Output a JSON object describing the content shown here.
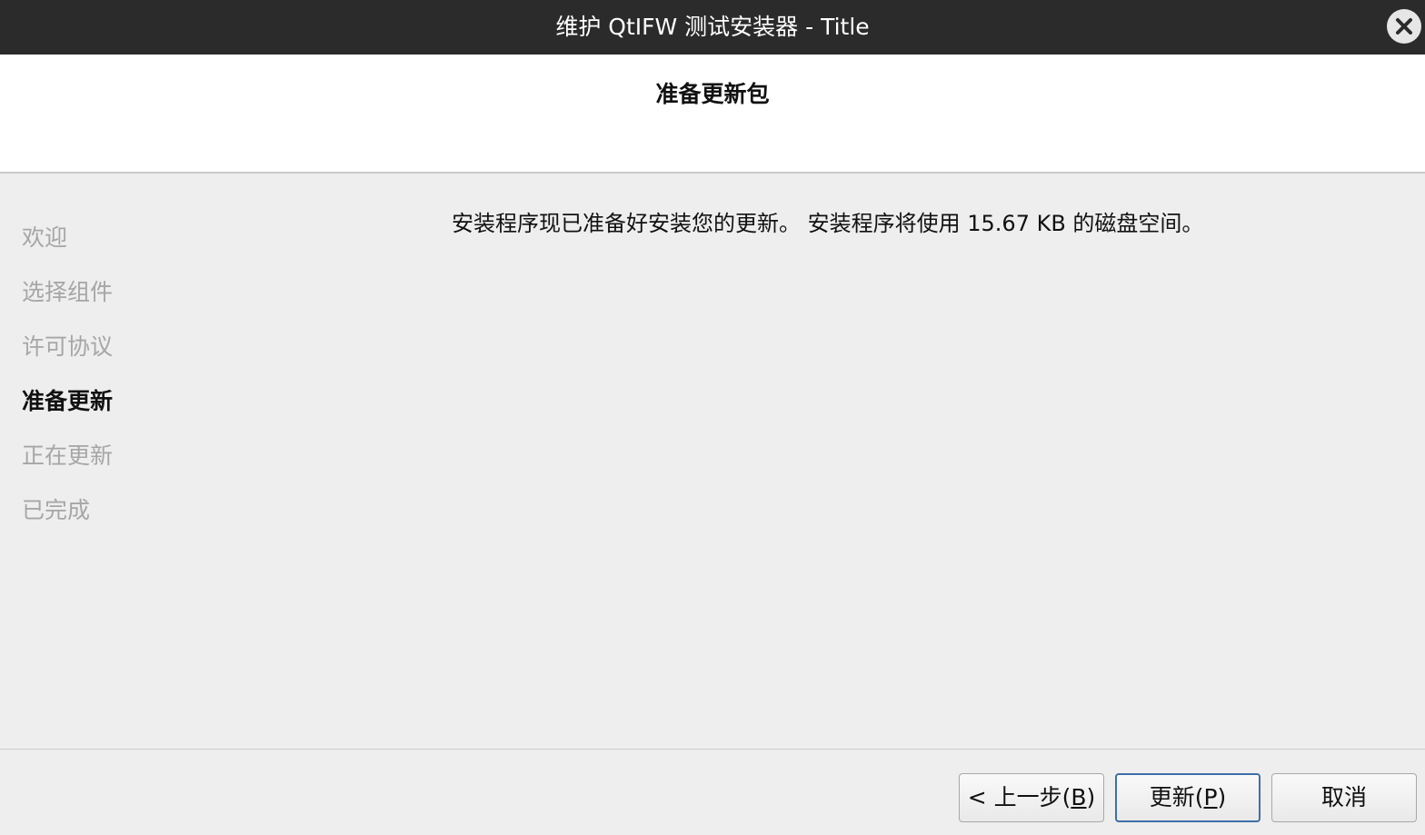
{
  "window": {
    "title": "维护 QtIFW 测试安装器 - Title",
    "close_icon": "close-icon"
  },
  "header": {
    "title": "准备更新包"
  },
  "sidebar": {
    "steps": [
      {
        "label": "欢迎",
        "active": false
      },
      {
        "label": "选择组件",
        "active": false
      },
      {
        "label": "许可协议",
        "active": false
      },
      {
        "label": "准备更新",
        "active": true
      },
      {
        "label": "正在更新",
        "active": false
      },
      {
        "label": "已完成",
        "active": false
      }
    ]
  },
  "main": {
    "message": "安装程序现已准备好安装您的更新。 安装程序将使用 15.67 KB 的磁盘空间。"
  },
  "buttons": {
    "back": {
      "prefix": "< 上一步(",
      "mnemonic": "B",
      "suffix": ")"
    },
    "update": {
      "prefix": "更新(",
      "mnemonic": "P",
      "suffix": ")"
    },
    "cancel": {
      "label": "取消"
    }
  },
  "colors": {
    "titlebar": "#2b2b2b",
    "background": "#eeeeee",
    "inactive_step": "#a6a6a6",
    "default_button_border": "#3f6fa8"
  }
}
